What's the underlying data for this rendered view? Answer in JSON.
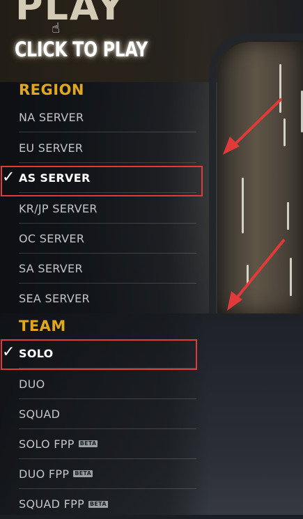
{
  "header": {
    "title": "PLAY",
    "cta_label": "CLICK TO PLAY"
  },
  "region": {
    "heading": "REGION",
    "items": [
      {
        "label": "NA SERVER"
      },
      {
        "label": "EU SERVER"
      },
      {
        "label": "AS SERVER",
        "selected": true
      },
      {
        "label": "KR/JP SERVER"
      },
      {
        "label": "OC SERVER"
      },
      {
        "label": "SA SERVER"
      },
      {
        "label": "SEA SERVER"
      }
    ]
  },
  "team": {
    "heading": "TEAM",
    "items": [
      {
        "label": "SOLO",
        "selected": true
      },
      {
        "label": "DUO"
      },
      {
        "label": "SQUAD"
      },
      {
        "label": "SOLO FPP",
        "badge": "BETA"
      },
      {
        "label": "DUO FPP",
        "badge": "BETA"
      },
      {
        "label": "SQUAD FPP",
        "badge": "BETA"
      }
    ]
  },
  "checkmark": "✓",
  "colors": {
    "heading_accent": "#e2a81c",
    "annotation_red": "#e03a3a",
    "selected_text": "#ffffff",
    "item_text": "#c2c5c8"
  },
  "icons": {
    "cursor": "hand-pointer-icon",
    "selected": "checkmark-icon",
    "annotation": "red-arrow-icon"
  }
}
